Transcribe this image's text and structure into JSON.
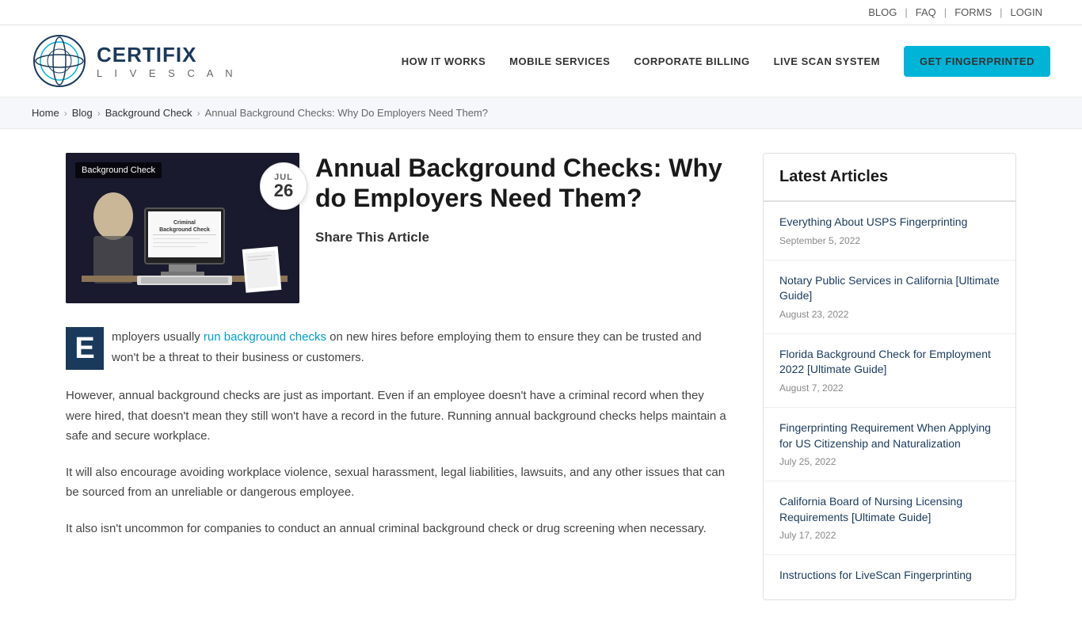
{
  "topbar": {
    "links": [
      {
        "label": "BLOG",
        "name": "blog-link"
      },
      {
        "label": "FAQ",
        "name": "faq-link"
      },
      {
        "label": "FORMS",
        "name": "forms-link"
      },
      {
        "label": "LOGIN",
        "name": "login-link"
      }
    ]
  },
  "header": {
    "logo": {
      "certifix": "CERTIFIX",
      "livescan": "L I V E S C A N"
    },
    "nav": [
      {
        "label": "HOW IT WORKS",
        "name": "nav-how-it-works"
      },
      {
        "label": "MOBILE SERVICES",
        "name": "nav-mobile-services"
      },
      {
        "label": "CORPORATE BILLING",
        "name": "nav-corporate-billing"
      },
      {
        "label": "LIVE SCAN SYSTEM",
        "name": "nav-live-scan-system"
      }
    ],
    "cta": "GET FINGERPRINTED"
  },
  "breadcrumb": {
    "items": [
      {
        "label": "Home",
        "name": "breadcrumb-home"
      },
      {
        "label": "Blog",
        "name": "breadcrumb-blog"
      },
      {
        "label": "Background Check",
        "name": "breadcrumb-background-check"
      },
      {
        "label": "Annual Background Checks: Why Do Employers Need Them?",
        "name": "breadcrumb-current"
      }
    ]
  },
  "article": {
    "badge": "Background Check",
    "date_month": "JUL",
    "date_day": "26",
    "title": "Annual Background Checks: Why do Employers Need Them?",
    "share_label": "Share This Article",
    "drop_cap_letter": "E",
    "intro_text": "mployers usually ",
    "intro_link": "run background checks",
    "intro_rest": " on new hires before employing them to ensure they can be trusted and won't be a threat to their business or customers.",
    "para1": "However, annual background checks are just as important. Even if an employee doesn't have a criminal record when they were hired, that doesn't mean they still won't have a record in the future. Running annual background checks helps maintain a safe and secure workplace.",
    "para2": "It will also encourage avoiding workplace violence, sexual harassment, legal liabilities, lawsuits, and any other issues that can be sourced from an unreliable or dangerous employee.",
    "para3": "It also isn't uncommon for companies to conduct an annual criminal background check or drug screening when necessary."
  },
  "sidebar": {
    "latest_articles_title": "Latest Articles",
    "articles": [
      {
        "title": "Everything About USPS Fingerprinting",
        "date": "September 5, 2022",
        "name": "article-usps-fingerprinting"
      },
      {
        "title": "Notary Public Services in California [Ultimate Guide]",
        "date": "August 23, 2022",
        "name": "article-notary-public"
      },
      {
        "title": "Florida Background Check for Employment 2022 [Ultimate Guide]",
        "date": "August 7, 2022",
        "name": "article-florida-background-check"
      },
      {
        "title": "Fingerprinting Requirement When Applying for US Citizenship and Naturalization",
        "date": "July 25, 2022",
        "name": "article-fingerprinting-citizenship"
      },
      {
        "title": "California Board of Nursing Licensing Requirements [Ultimate Guide]",
        "date": "July 17, 2022",
        "name": "article-california-nursing"
      },
      {
        "title": "Instructions for LiveScan Fingerprinting",
        "date": "",
        "name": "article-livescan-instructions"
      }
    ]
  }
}
